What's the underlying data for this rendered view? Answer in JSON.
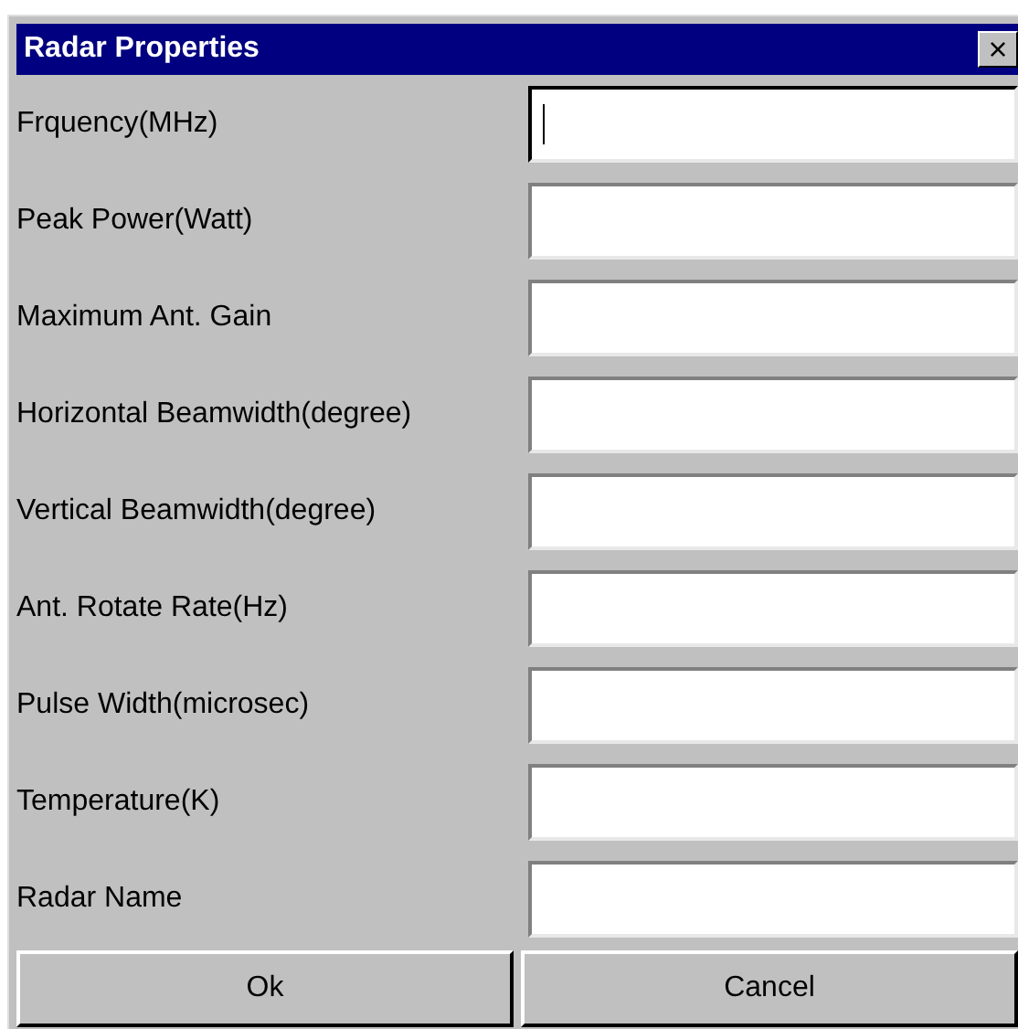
{
  "window": {
    "title": "Radar Properties",
    "close": "×"
  },
  "fields": [
    {
      "label": "Frquency(MHz)",
      "focused": true
    },
    {
      "label": "Peak Power(Watt)",
      "focused": false
    },
    {
      "label": "Maximum Ant. Gain",
      "focused": false
    },
    {
      "label": "Horizontal Beamwidth(degree)",
      "focused": false
    },
    {
      "label": "Vertical Beamwidth(degree)",
      "focused": false
    },
    {
      "label": "Ant. Rotate Rate(Hz)",
      "focused": false
    },
    {
      "label": "Pulse Width(microsec)",
      "focused": false
    },
    {
      "label": "Temperature(K)",
      "focused": false
    },
    {
      "label": "Radar Name",
      "focused": false
    }
  ],
  "buttons": [
    "Ok",
    "Cancel"
  ]
}
